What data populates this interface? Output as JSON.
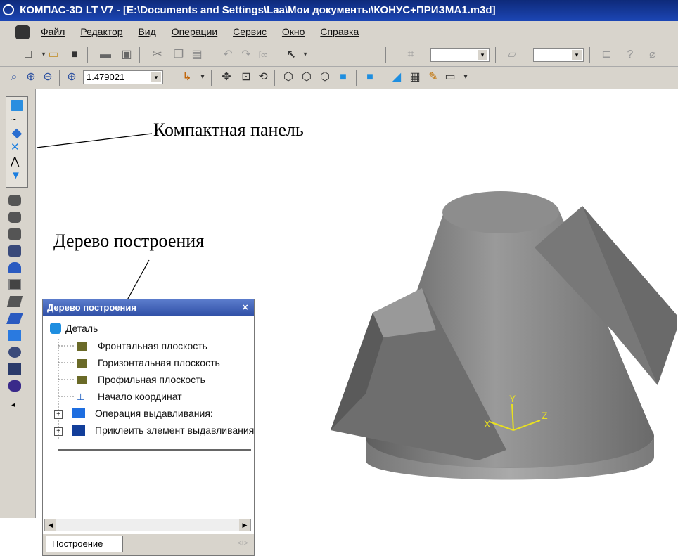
{
  "window": {
    "title": "КОМПАС-3D LT V7 - [E:\\Documents and Settings\\Laa\\Мои документы\\КОНУС+ПРИЗМА1.m3d]"
  },
  "menu": {
    "items": [
      "Файл",
      "Редактор",
      "Вид",
      "Операции",
      "Сервис",
      "Окно",
      "Справка"
    ]
  },
  "toolbar": {
    "zoom_value": "1.479021"
  },
  "annotations": {
    "compact_panel": "Компактная панель",
    "build_tree": "Дерево построения"
  },
  "tree": {
    "title": "Дерево построения",
    "close": "×",
    "root": "Деталь",
    "items": [
      {
        "label": "Фронтальная плоскость"
      },
      {
        "label": "Горизонтальная плоскость"
      },
      {
        "label": "Профильная плоскость"
      },
      {
        "label": "Начало координат"
      },
      {
        "label": "Операция выдавливания:",
        "expand": "+"
      },
      {
        "label": "Приклеить элемент выдавливания",
        "expand": "+"
      }
    ],
    "tab": "Построение"
  },
  "axes": {
    "x": "X",
    "y": "Y",
    "z": "Z"
  },
  "colors": {
    "title_bar": "#1c46b5",
    "panel": "#d8d4cc",
    "model": "#8a8a8a",
    "axes": "#e8e020"
  }
}
